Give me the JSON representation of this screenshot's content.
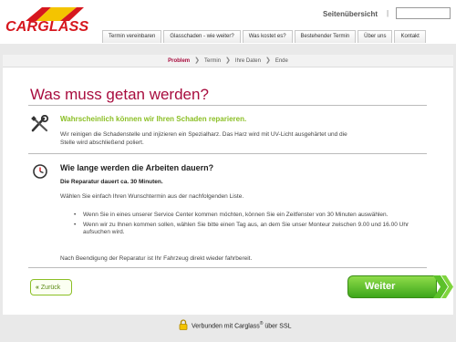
{
  "brand": {
    "name": "CARGLASS",
    "red": "#d6171e",
    "yellow": "#f4c400"
  },
  "header": {
    "sitemap_label": "Seitenübersicht",
    "separator": "|",
    "search": {
      "value": "",
      "placeholder": ""
    }
  },
  "nav": {
    "tabs": [
      {
        "label": "Termin vereinbaren"
      },
      {
        "label": "Glasschaden - wie weiter?"
      },
      {
        "label": "Was kostet es?"
      },
      {
        "label": "Bestehender Termin"
      },
      {
        "label": "Über uns"
      },
      {
        "label": "Kontakt"
      }
    ]
  },
  "progress": {
    "steps": [
      "Problem",
      "Termin",
      "Ihre Daten",
      "Ende"
    ],
    "active_index": 0,
    "arrow": "❯"
  },
  "main": {
    "title": "Was muss getan werden?",
    "repair": {
      "heading": "Wahrscheinlich können wir Ihren Schaden reparieren.",
      "text": "Wir reinigen die Schadenstelle und injizieren ein Spezialharz. Das Harz wird mit UV-Licht ausgehärtet und die Stelle wird abschließend poliert."
    },
    "duration": {
      "heading": "Wie lange werden die Arbeiten dauern?",
      "bold": "Die Reparatur dauert ca. 30 Minuten.",
      "choose": "Wählen Sie einfach Ihren Wunschtermin aus der nachfolgenden Liste.",
      "bullets": [
        "Wenn Sie in eines unserer Service Center kommen möchten, können Sie ein Zeitfenster von 30 Minuten auswählen.",
        "Wenn wir zu Ihnen kommen sollen, wählen Sie bitte einen Tag aus, an dem Sie unser Monteur zwischen 9.00 und 16.00 Uhr aufsuchen wird."
      ],
      "after": "Nach Beendigung der Reparatur ist Ihr Fahrzeug direkt wieder fahrbereit."
    },
    "back_label": "Zurück",
    "back_chevron": "«",
    "next_label": "Weiter",
    "accent_green": "#8bbf25",
    "title_color": "#a80c3e"
  },
  "footer": {
    "ssl_prefix": "Verbunden mit Carglass",
    "ssl_sup": "®",
    "ssl_suffix": " über SSL"
  }
}
